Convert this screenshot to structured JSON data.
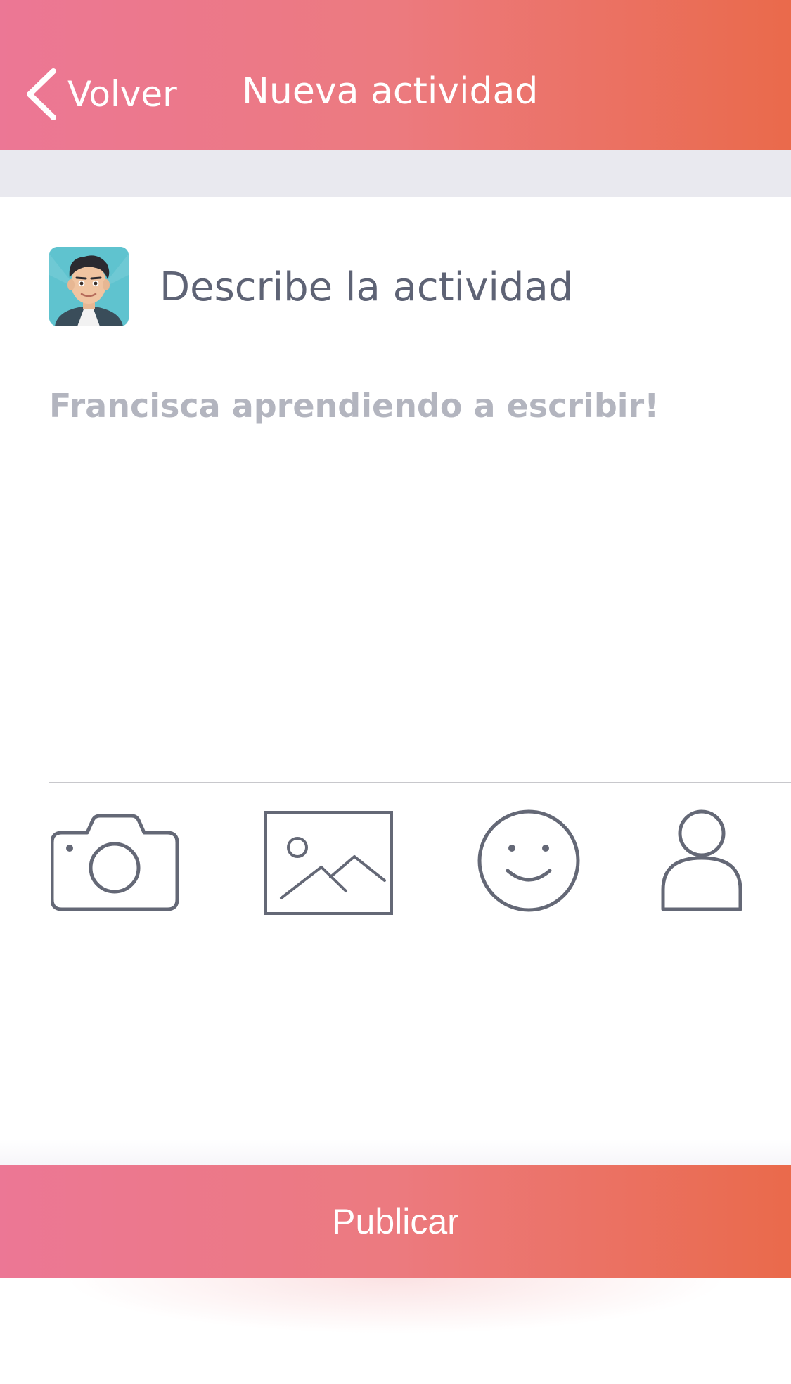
{
  "header": {
    "back_label": "Volver",
    "title": "Nueva actividad",
    "gradient_colors": [
      "#ec7795",
      "#ec7a7f",
      "#ea6a4b"
    ]
  },
  "composer": {
    "avatar": "user-avatar",
    "prompt": "Describe la actividad",
    "placeholder": "Francisca aprendiendo a escribir!",
    "value": ""
  },
  "toolbar": {
    "icons": [
      "camera-icon",
      "image-icon",
      "emoji-icon",
      "person-icon"
    ],
    "icon_color": "#646876"
  },
  "footer": {
    "publish_label": "Publicar"
  }
}
